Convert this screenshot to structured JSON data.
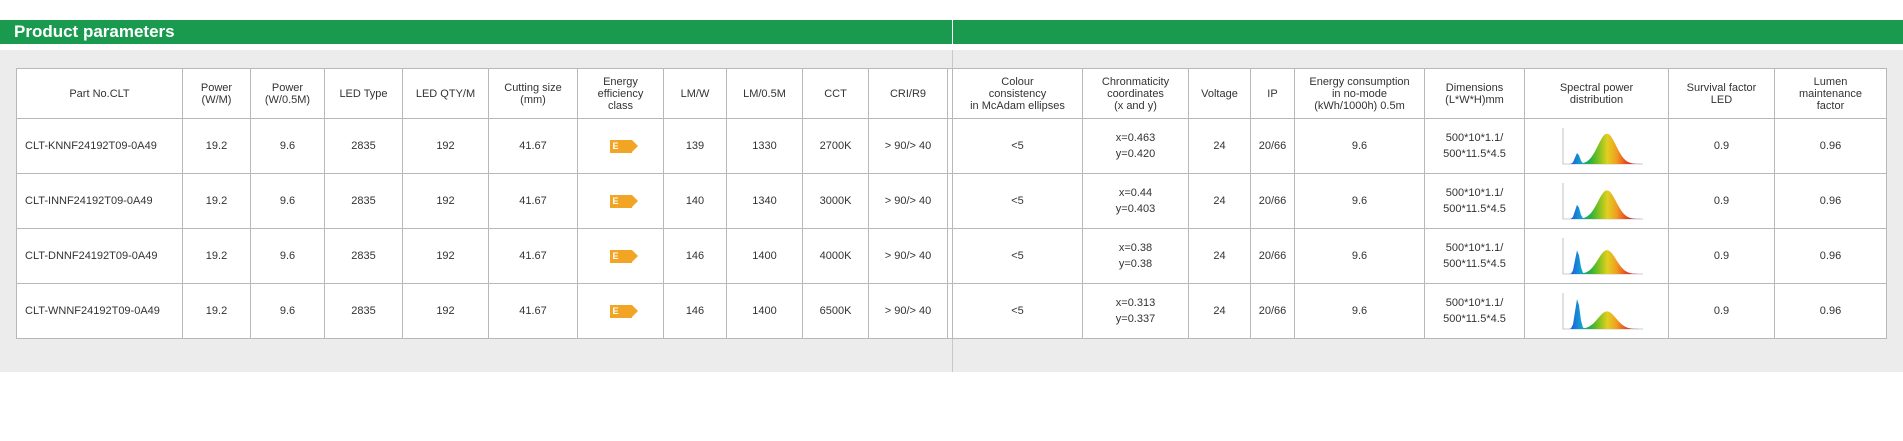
{
  "section": {
    "title": "Product parameters"
  },
  "table_left": {
    "headers": [
      "Part No.CLT",
      "Power\n(W/M)",
      "Power\n(W/0.5M)",
      "LED Type",
      "LED QTY/M",
      "Cutting size\n(mm)",
      "Energy\nefficiency\nclass",
      "LM/W",
      "LM/0.5M",
      "CCT",
      "CRI/R9",
      ""
    ],
    "rows": [
      {
        "part": "CLT-KNNF24192T09-0A49",
        "power_m": "19.2",
        "power_half": "9.6",
        "led_type": "2835",
        "led_qty": "192",
        "cut": "41.67",
        "energy": "E",
        "lmw": "139",
        "lm_half": "1330",
        "cct": "2700K",
        "cri": "> 90/> 40"
      },
      {
        "part": "CLT-INNF24192T09-0A49",
        "power_m": "19.2",
        "power_half": "9.6",
        "led_type": "2835",
        "led_qty": "192",
        "cut": "41.67",
        "energy": "E",
        "lmw": "140",
        "lm_half": "1340",
        "cct": "3000K",
        "cri": "> 90/> 40"
      },
      {
        "part": "CLT-DNNF24192T09-0A49",
        "power_m": "19.2",
        "power_half": "9.6",
        "led_type": "2835",
        "led_qty": "192",
        "cut": "41.67",
        "energy": "E",
        "lmw": "146",
        "lm_half": "1400",
        "cct": "4000K",
        "cri": "> 90/> 40"
      },
      {
        "part": "CLT-WNNF24192T09-0A49",
        "power_m": "19.2",
        "power_half": "9.6",
        "led_type": "2835",
        "led_qty": "192",
        "cut": "41.67",
        "energy": "E",
        "lmw": "146",
        "lm_half": "1400",
        "cct": "6500K",
        "cri": "> 90/> 40"
      }
    ]
  },
  "table_right": {
    "headers": [
      "Colour\nconsistency\nin McAdam ellipses",
      "Chronmaticity\ncoordinates\n(x and y)",
      "Voltage",
      "IP",
      "Energy consumption\nin no-mode\n(kWh/1000h) 0.5m",
      "Dimensions\n(L*W*H)mm",
      "Spectral power\ndistribution",
      "Survival factor\nLED",
      "Lumen\nmaintenance\nfactor"
    ],
    "rows": [
      {
        "mcadam": "<5",
        "x": "x=0.463",
        "y": "y=0.420",
        "voltage": "24",
        "ip": "20/66",
        "energy_consumption": "9.6",
        "dim1": "500*10*1.1/",
        "dim2": "500*11.5*4.5",
        "survival": "0.9",
        "lumen": "0.96"
      },
      {
        "mcadam": "<5",
        "x": "x=0.44",
        "y": "y=0.403",
        "voltage": "24",
        "ip": "20/66",
        "energy_consumption": "9.6",
        "dim1": "500*10*1.1/",
        "dim2": "500*11.5*4.5",
        "survival": "0.9",
        "lumen": "0.96"
      },
      {
        "mcadam": "<5",
        "x": "x=0.38",
        "y": "y=0.38",
        "voltage": "24",
        "ip": "20/66",
        "energy_consumption": "9.6",
        "dim1": "500*10*1.1/",
        "dim2": "500*11.5*4.5",
        "survival": "0.9",
        "lumen": "0.96"
      },
      {
        "mcadam": "<5",
        "x": "x=0.313",
        "y": "y=0.337",
        "voltage": "24",
        "ip": "20/66",
        "energy_consumption": "9.6",
        "dim1": "500*10*1.1/",
        "dim2": "500*11.5*4.5",
        "survival": "0.9",
        "lumen": "0.96"
      }
    ]
  },
  "colors": {
    "header_green": "#1a9a4e",
    "energy_tag": "#f2a524",
    "panel_gray": "#ececec"
  }
}
